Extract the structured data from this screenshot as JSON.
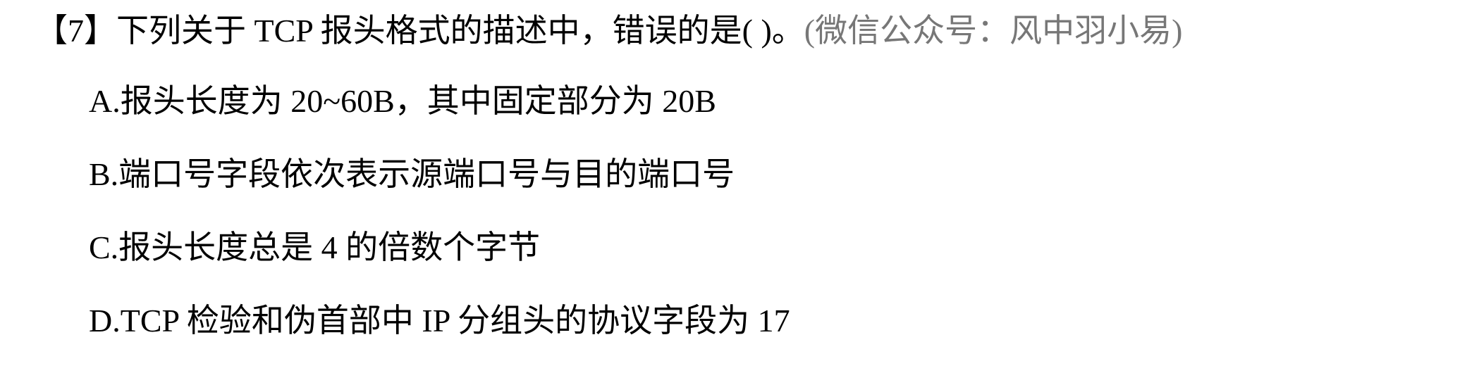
{
  "question": {
    "number": "【7】",
    "stem": "下列关于 TCP 报头格式的描述中，错误的是(      )。",
    "source": "(微信公众号：风中羽小易)"
  },
  "options": [
    {
      "text": "A.报头长度为 20~60B，其中固定部分为 20B"
    },
    {
      "text": "B.端口号字段依次表示源端口号与目的端口号"
    },
    {
      "text": "C.报头长度总是 4 的倍数个字节"
    },
    {
      "text": "D.TCP 检验和伪首部中 IP 分组头的协议字段为 17"
    }
  ]
}
